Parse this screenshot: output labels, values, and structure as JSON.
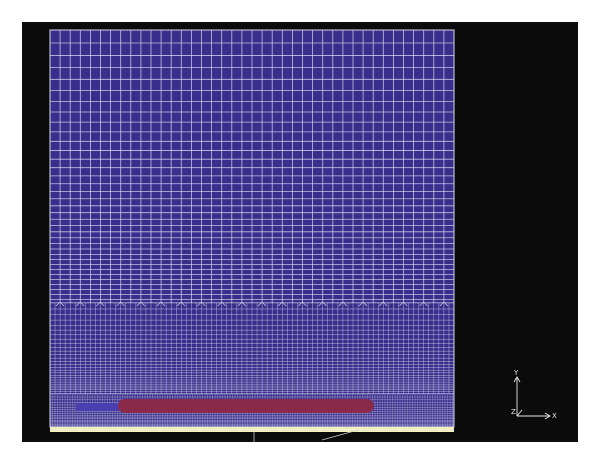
{
  "viewport": {
    "background": "#0b0b0b",
    "mesh_fill": "#3a2e8c",
    "mesh_line_color": "#d9d9ef",
    "body_color": "#8a2a4a",
    "inlet_strip_color": "#4a3fb0",
    "ground_color": "#f2efc0",
    "orientation_triad": {
      "y_label": "Y",
      "x_label": "X",
      "z_label": "Z",
      "color": "#e8e8e8"
    }
  }
}
